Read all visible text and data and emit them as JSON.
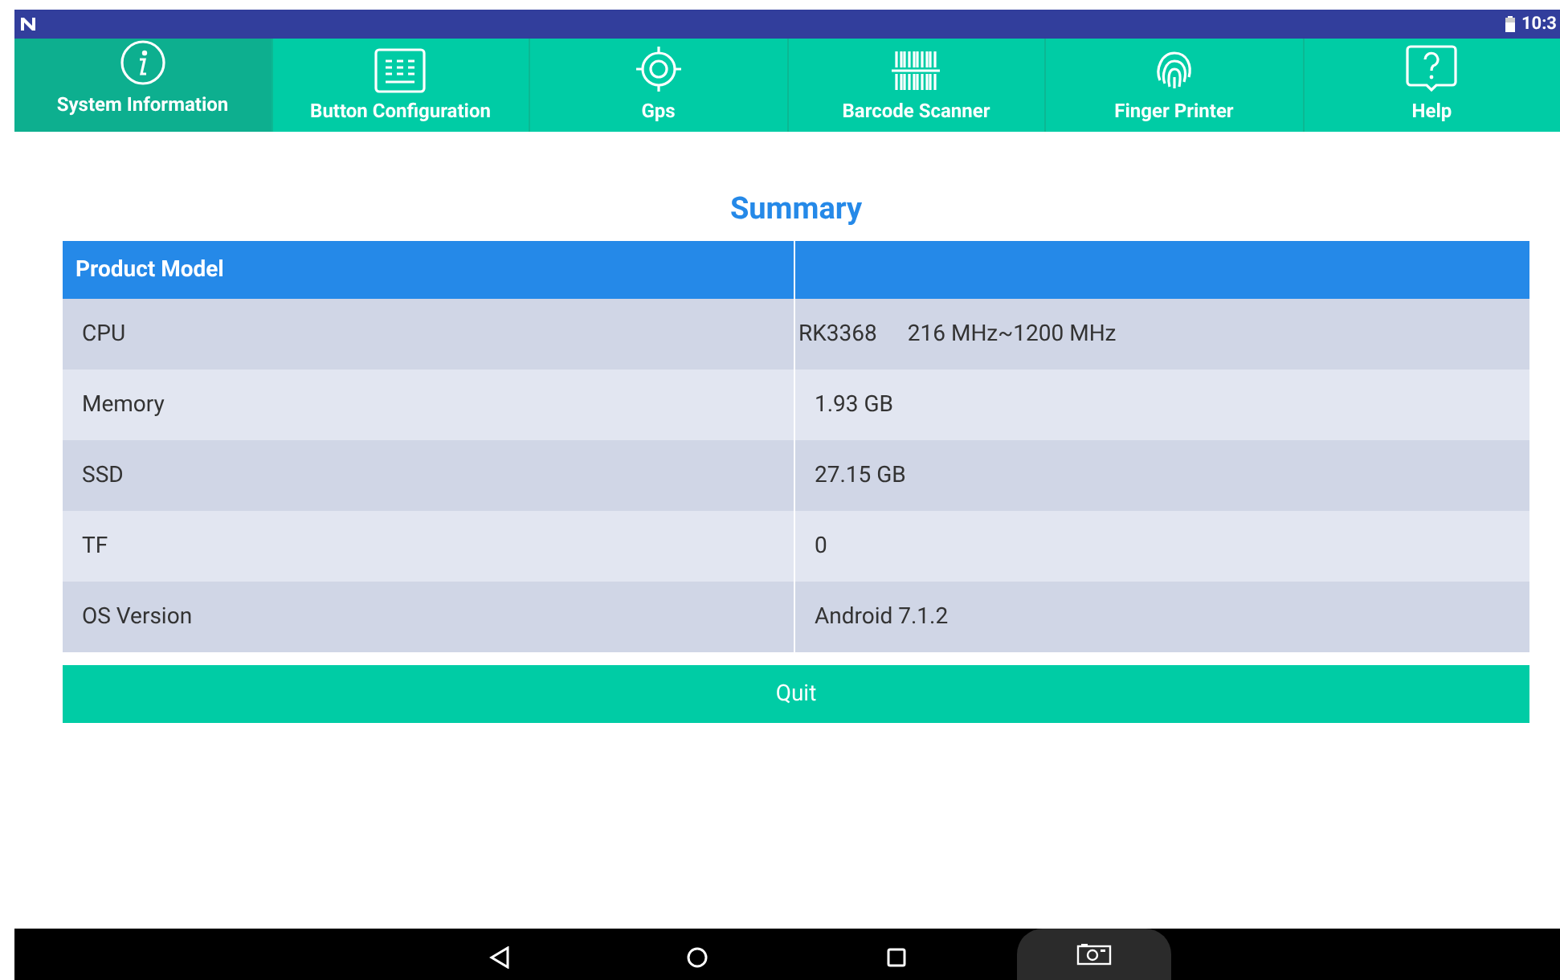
{
  "status_bar": {
    "time": "10:3"
  },
  "tabs": [
    {
      "label": "System Information",
      "kind": "info",
      "selected": true
    },
    {
      "label": "Button Configuration",
      "kind": "keyboard",
      "selected": false
    },
    {
      "label": "Gps",
      "kind": "target",
      "selected": false
    },
    {
      "label": "Barcode Scanner",
      "kind": "barcode",
      "selected": false
    },
    {
      "label": "Finger Printer",
      "kind": "fingerprint",
      "selected": false
    },
    {
      "label": "Help",
      "kind": "help",
      "selected": false
    }
  ],
  "title": "Summary",
  "table": {
    "header": "Product Model",
    "rows": [
      {
        "label": "CPU",
        "values": [
          "RK3368",
          "216 MHz~1200 MHz"
        ]
      },
      {
        "label": "Memory",
        "values": [
          "1.93 GB"
        ]
      },
      {
        "label": "SSD",
        "values": [
          "27.15 GB"
        ]
      },
      {
        "label": "TF",
        "values": [
          "0"
        ]
      },
      {
        "label": "OS Version",
        "values": [
          "Android 7.1.2"
        ]
      }
    ]
  },
  "quit_button": "Quit"
}
